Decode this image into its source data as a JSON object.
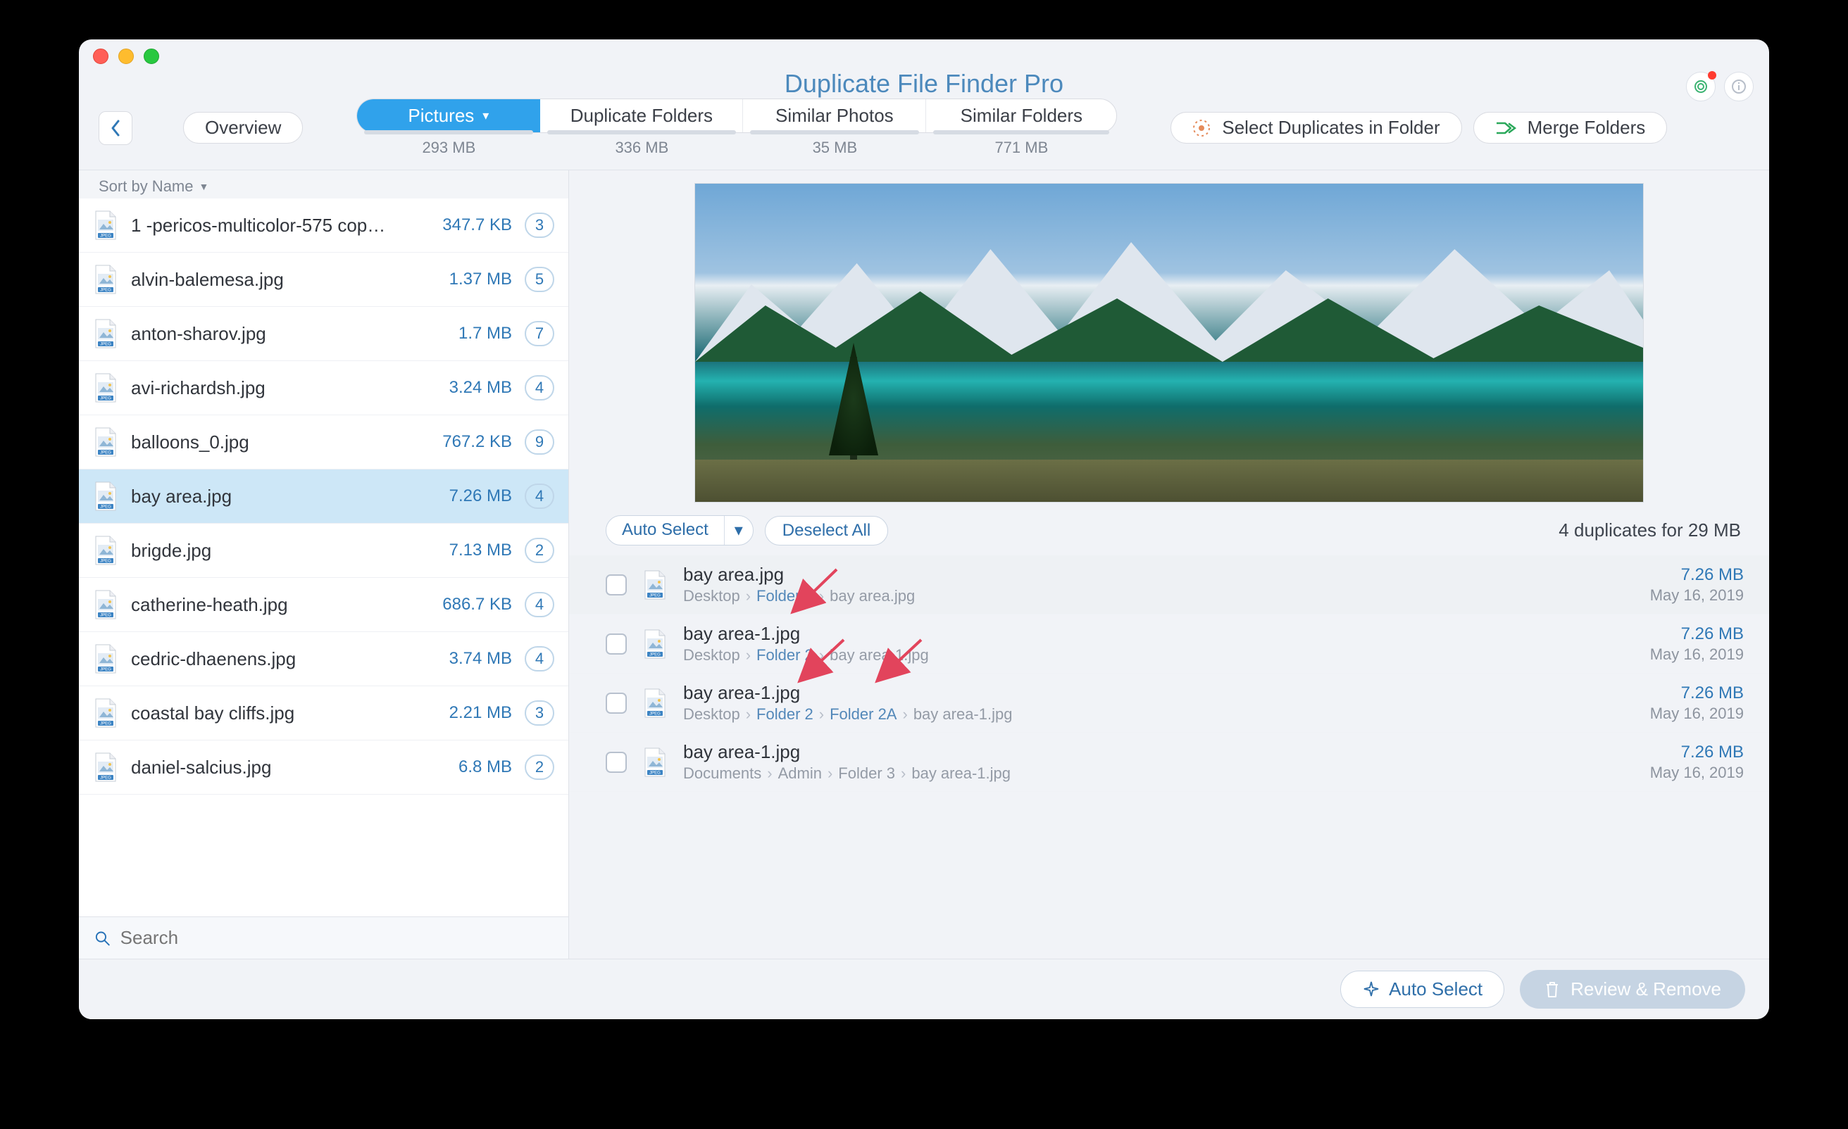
{
  "app_title": "Duplicate File Finder Pro",
  "toolbar": {
    "overview_label": "Overview",
    "select_duplicates_label": "Select Duplicates in Folder",
    "merge_folders_label": "Merge Folders"
  },
  "tabs": [
    {
      "label": "Pictures",
      "size": "293 MB",
      "active": true
    },
    {
      "label": "Duplicate Folders",
      "size": "336 MB",
      "active": false
    },
    {
      "label": "Similar Photos",
      "size": "35 MB",
      "active": false
    },
    {
      "label": "Similar Folders",
      "size": "771 MB",
      "active": false
    }
  ],
  "sort_label": "Sort by Name",
  "search_placeholder": "Search",
  "sidebar_items": [
    {
      "name": "1 -pericos-multicolor-575 cop…",
      "size": "347.7 KB",
      "count": "3",
      "selected": false
    },
    {
      "name": "alvin-balemesa.jpg",
      "size": "1.37 MB",
      "count": "5",
      "selected": false
    },
    {
      "name": "anton-sharov.jpg",
      "size": "1.7 MB",
      "count": "7",
      "selected": false
    },
    {
      "name": "avi-richardsh.jpg",
      "size": "3.24 MB",
      "count": "4",
      "selected": false
    },
    {
      "name": "balloons_0.jpg",
      "size": "767.2 KB",
      "count": "9",
      "selected": false
    },
    {
      "name": "bay area.jpg",
      "size": "7.26 MB",
      "count": "4",
      "selected": true
    },
    {
      "name": "brigde.jpg",
      "size": "7.13 MB",
      "count": "2",
      "selected": false
    },
    {
      "name": "catherine-heath.jpg",
      "size": "686.7 KB",
      "count": "4",
      "selected": false
    },
    {
      "name": "cedric-dhaenens.jpg",
      "size": "3.74 MB",
      "count": "4",
      "selected": false
    },
    {
      "name": "coastal bay cliffs.jpg",
      "size": "2.21 MB",
      "count": "3",
      "selected": false
    },
    {
      "name": "daniel-salcius.jpg",
      "size": "6.8 MB",
      "count": "2",
      "selected": false
    }
  ],
  "detail": {
    "auto_select_label": "Auto Select",
    "deselect_all_label": "Deselect All",
    "summary": "4 duplicates for 29 MB",
    "duplicates": [
      {
        "name": "bay area.jpg",
        "path": [
          {
            "t": "Desktop"
          },
          {
            "t": "Folder 1",
            "hl": true
          },
          {
            "t": "bay area.jpg"
          }
        ],
        "size": "7.26 MB",
        "date": "May 16, 2019"
      },
      {
        "name": "bay area-1.jpg",
        "path": [
          {
            "t": "Desktop"
          },
          {
            "t": "Folder 2",
            "hl": true
          },
          {
            "t": "bay area-1.jpg"
          }
        ],
        "size": "7.26 MB",
        "date": "May 16, 2019"
      },
      {
        "name": "bay area-1.jpg",
        "path": [
          {
            "t": "Desktop"
          },
          {
            "t": "Folder 2",
            "hl": true
          },
          {
            "t": "Folder 2A",
            "hl": true
          },
          {
            "t": "bay area-1.jpg"
          }
        ],
        "size": "7.26 MB",
        "date": "May 16, 2019"
      },
      {
        "name": "bay area-1.jpg",
        "path": [
          {
            "t": "Documents"
          },
          {
            "t": "Admin"
          },
          {
            "t": "Folder 3"
          },
          {
            "t": "bay area-1.jpg"
          }
        ],
        "size": "7.26 MB",
        "date": "May 16, 2019"
      }
    ]
  },
  "footer": {
    "auto_select_label": "Auto Select",
    "review_remove_label": "Review & Remove"
  }
}
